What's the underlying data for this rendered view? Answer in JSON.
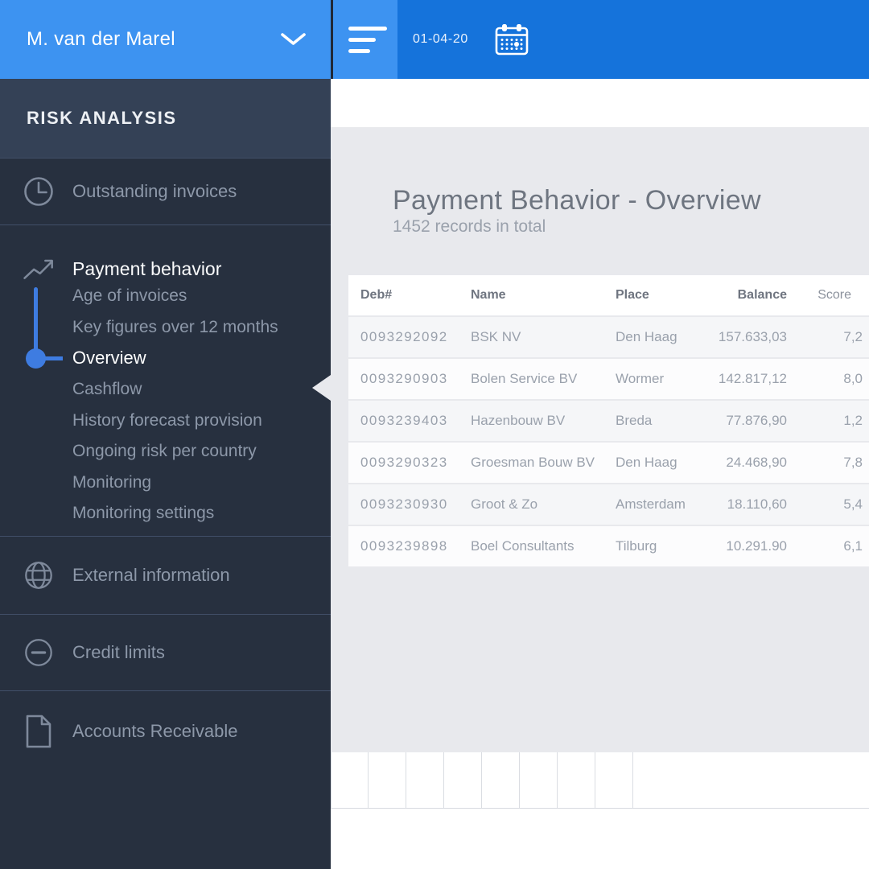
{
  "user": {
    "name": "M. van der Marel"
  },
  "topbar": {
    "date": "01-04-20",
    "icons": [
      "menu-icon",
      "calendar-icon"
    ]
  },
  "sidebar": {
    "section_title": "RISK ANALYSIS",
    "items": [
      {
        "label": "Outstanding invoices",
        "icon": "clock-icon",
        "active": false
      },
      {
        "label": "Payment behavior",
        "icon": "trending-up-icon",
        "active": true
      },
      {
        "label": "External information",
        "icon": "globe-icon",
        "active": false
      },
      {
        "label": "Credit limits",
        "icon": "minus-circle-icon",
        "active": false
      },
      {
        "label": "Accounts Receivable",
        "icon": "document-icon",
        "active": false
      }
    ],
    "payment_behavior_subitems": [
      {
        "label": "Age of invoices",
        "active": false
      },
      {
        "label": "Key figures over 12 months",
        "active": false
      },
      {
        "label": "Overview",
        "active": true
      },
      {
        "label": "Cashflow",
        "active": false
      },
      {
        "label": "History forecast provision",
        "active": false
      },
      {
        "label": "Ongoing risk per country",
        "active": false
      },
      {
        "label": "Monitoring",
        "active": false
      },
      {
        "label": "Monitoring settings",
        "active": false
      }
    ]
  },
  "main": {
    "title": "Payment Behavior - Overview",
    "subtitle": "1452 records in total",
    "table": {
      "columns": [
        "Deb#",
        "Name",
        "Place",
        "Balance",
        "Score"
      ],
      "rows": [
        [
          "0093292092",
          "BSK NV",
          "Den Haag",
          "157.633,03",
          "7,2"
        ],
        [
          "0093290903",
          "Bolen Service BV",
          "Wormer",
          "142.817,12",
          "8,0"
        ],
        [
          "0093239403",
          "Hazenbouw BV",
          "Breda",
          "77.876,90",
          "1,2"
        ],
        [
          "0093290323",
          "Groesman Bouw BV",
          "Den Haag",
          "24.468,90",
          "7,8"
        ],
        [
          "0093230930",
          "Groot & Zo",
          "Amsterdam",
          "18.110,60",
          "5,4"
        ],
        [
          "0093239898",
          "Boel Consultants",
          "Tilburg",
          "10.291.90",
          "6,1"
        ]
      ]
    },
    "bottom_grid_cell_count": 8
  },
  "colors": {
    "topbar_blue": "#1573DB",
    "accent_blue": "#3D93F1",
    "connector_blue": "#3E7CE1",
    "sidebar_navy": "#27303F",
    "sidebar_band_navy": "#344156",
    "panel_gray": "#E8E9ED",
    "muted_text": "#8D98A9"
  }
}
